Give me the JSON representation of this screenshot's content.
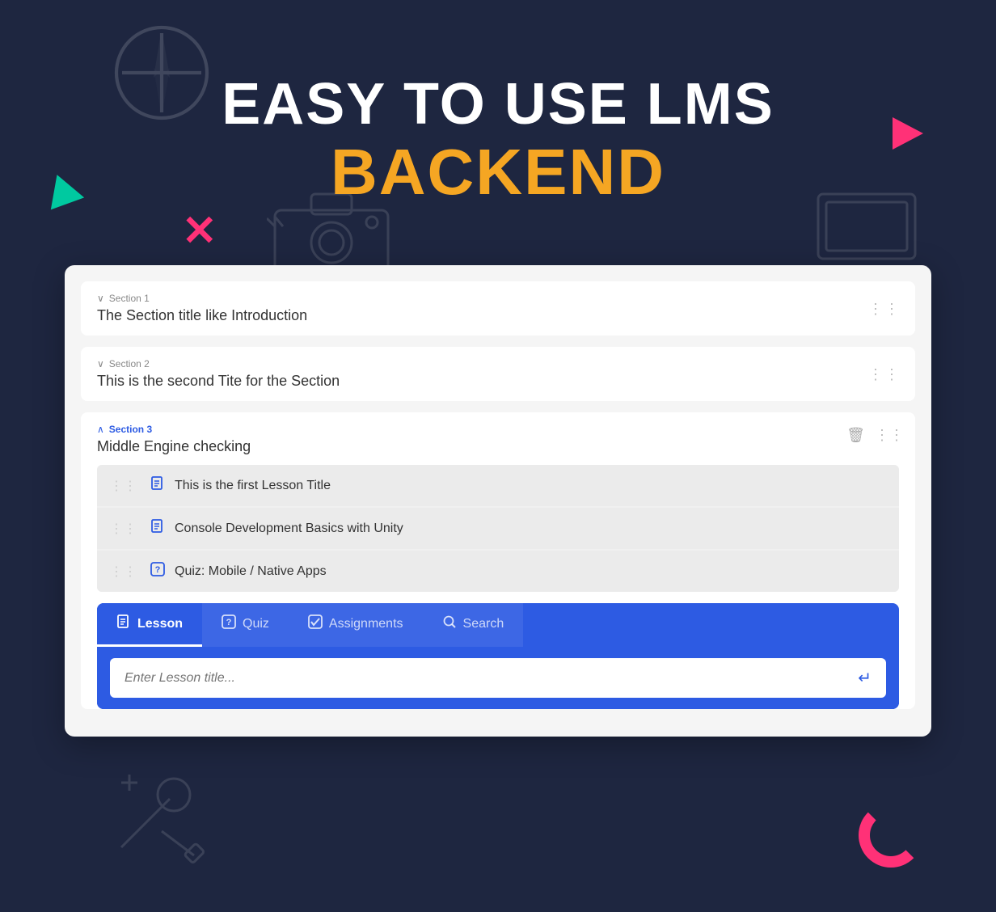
{
  "header": {
    "line1": "EASY TO USE LMS",
    "line2": "BACKEND"
  },
  "sections": [
    {
      "id": "section1",
      "label": "Section 1",
      "title": "The Section title like Introduction",
      "expanded": false,
      "active": false
    },
    {
      "id": "section2",
      "label": "Section 2",
      "title": "This is the second Tite for the Section",
      "expanded": false,
      "active": false
    },
    {
      "id": "section3",
      "label": "Section 3",
      "title": "Middle Engine checking",
      "expanded": true,
      "active": true
    }
  ],
  "lessons": [
    {
      "id": "lesson1",
      "title": "This is the first Lesson Title",
      "type": "lesson"
    },
    {
      "id": "lesson2",
      "title": "Console Development Basics with Unity",
      "type": "lesson"
    },
    {
      "id": "lesson3",
      "title": "Quiz: Mobile / Native Apps",
      "type": "quiz"
    }
  ],
  "tabs": [
    {
      "id": "lesson",
      "label": "Lesson",
      "active": true
    },
    {
      "id": "quiz",
      "label": "Quiz",
      "active": false
    },
    {
      "id": "assignments",
      "label": "Assignments",
      "active": false
    },
    {
      "id": "search",
      "label": "Search",
      "active": false
    }
  ],
  "input": {
    "placeholder": "Enter Lesson title..."
  },
  "icons": {
    "drag": "⋮⋮",
    "chevron_down": "∨",
    "chevron_up": "∧",
    "lesson": "📄",
    "quiz": "❓",
    "trash": "🗑",
    "enter": "↵"
  }
}
